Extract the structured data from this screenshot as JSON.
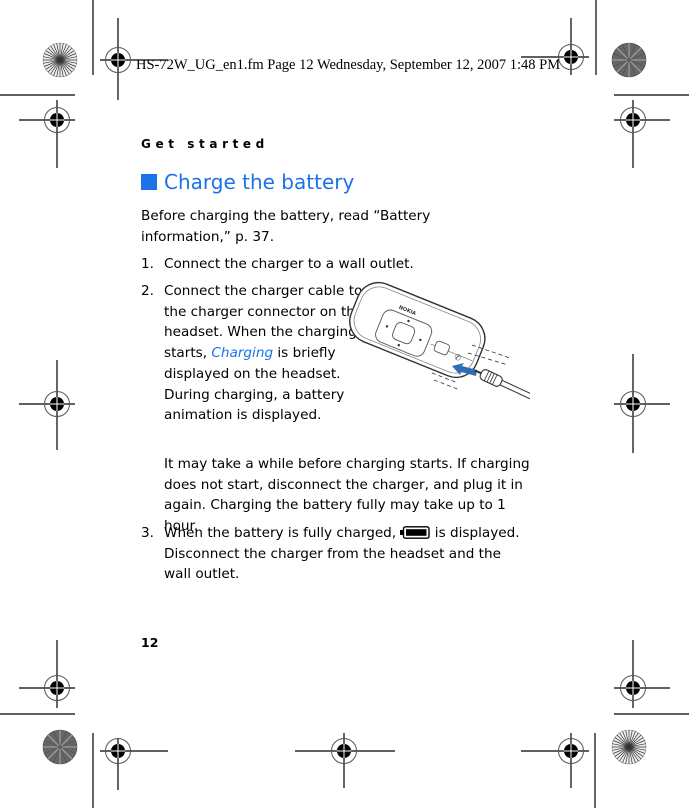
{
  "slug_line": "HS-72W_UG_en1.fm  Page 12  Wednesday, September 12, 2007  1:48 PM",
  "running_head": "Get started",
  "section": {
    "title": "Charge the battery",
    "accent_color": "#1a73e8"
  },
  "intro": "Before charging the battery, read “Battery information,” p. 37.",
  "steps": [
    {
      "number": "1.",
      "text": "Connect the charger to a wall outlet."
    },
    {
      "number": "2.",
      "text_before": "Connect the charger cable to the charger connector on the headset. When the charging starts, ",
      "emphasis": "Charging",
      "text_after": " is briefly displayed on the headset. During charging, a battery animation is displayed.",
      "note": "It may take a while before charging starts. If charging does not start, disconnect the charger, and plug it in again. Charging the battery fully may take up to 1 hour."
    },
    {
      "number": "3.",
      "text_before": "When the battery is fully charged, ",
      "icon": "battery-full-icon",
      "text_after": " is displayed. Disconnect the charger from the headset and the wall outlet."
    }
  ],
  "illustration": {
    "label": "headset-charger-connection",
    "brand_text": "NOKIA",
    "arrow_color": "#2f6db5"
  },
  "page_number": "12"
}
